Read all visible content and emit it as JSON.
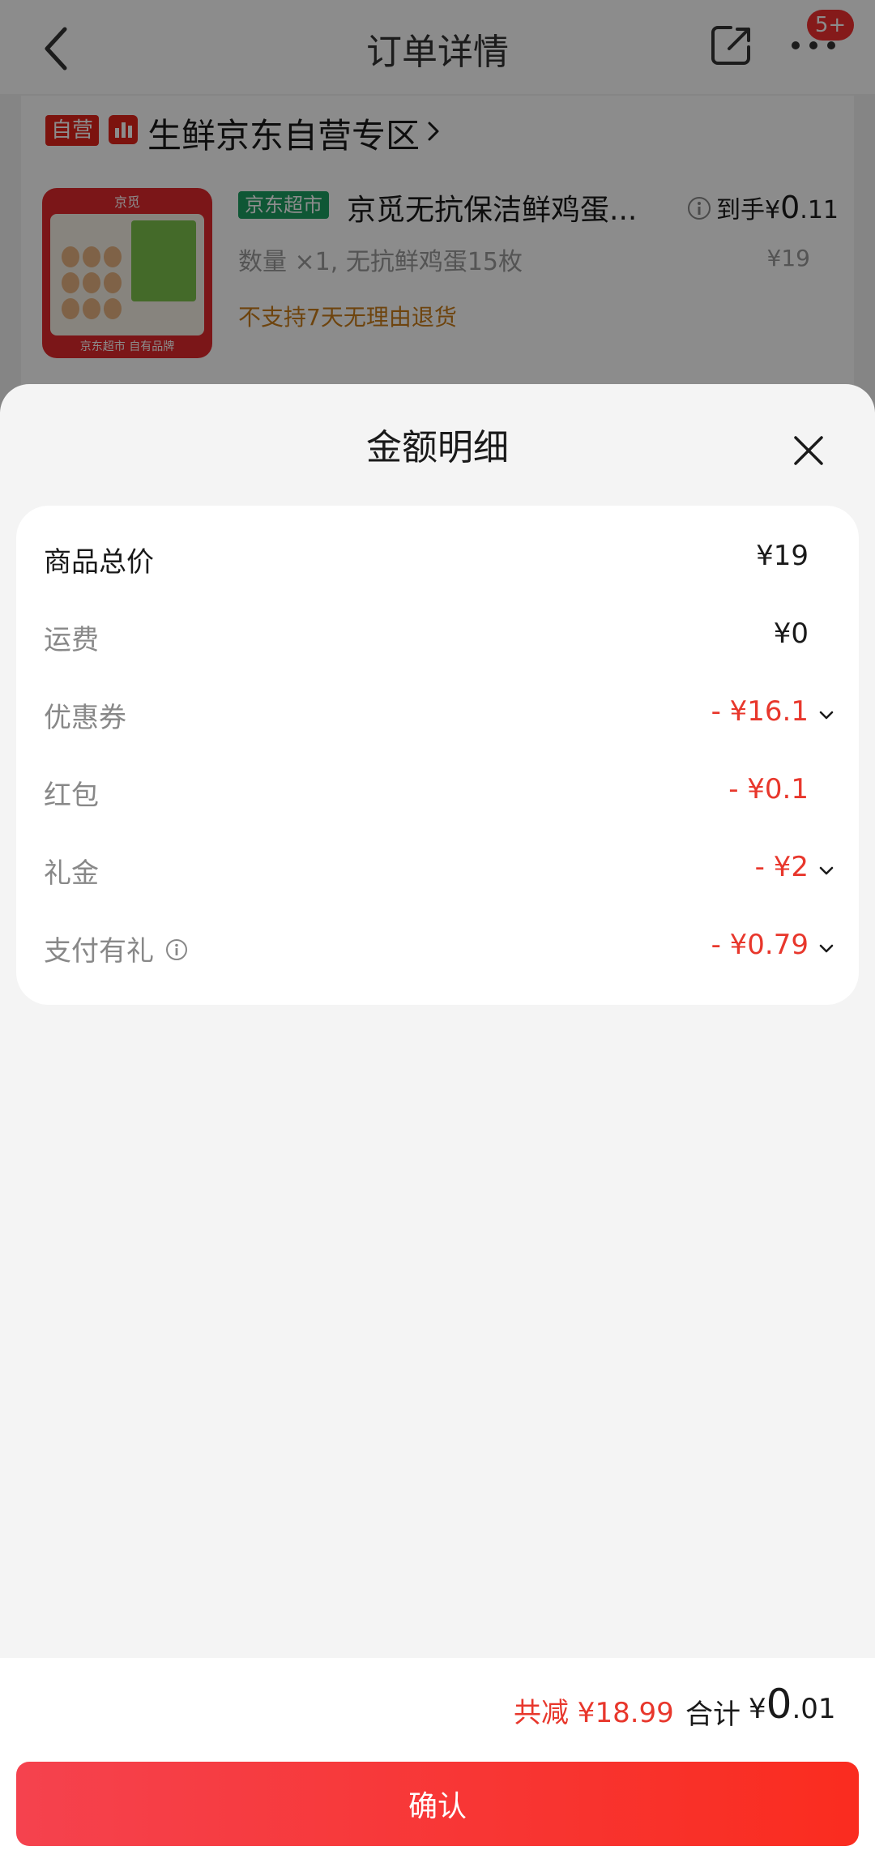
{
  "header": {
    "title": "订单详情",
    "badge": "5+"
  },
  "store": {
    "self_tag": "自营",
    "name": "生鲜京东自营专区"
  },
  "product": {
    "thumb_logo": "京觅",
    "thumb_footer": "京东超市 自有品牌",
    "channel_tag": "京东超市",
    "name": "京觅无抗保洁鲜鸡蛋...",
    "arrive_label": "到手",
    "arrive_currency": "¥",
    "arrive_int": "0",
    "arrive_dec": ".11",
    "quantity": "数量 ×1, 无抗鲜鸡蛋15枚",
    "original_price": "¥19",
    "return_policy": "不支持7天无理由退货"
  },
  "sheet": {
    "title": "金额明细",
    "rows": [
      {
        "label": "商品总价",
        "value": "¥19"
      },
      {
        "label": "运费",
        "value": "¥0"
      },
      {
        "label": "优惠券",
        "value": "- ¥16.1"
      },
      {
        "label": "红包",
        "value": "- ¥0.1"
      },
      {
        "label": "礼金",
        "value": "- ¥2"
      },
      {
        "label": "支付有礼",
        "value": "- ¥0.79"
      }
    ]
  },
  "footer": {
    "saved": "共减 ¥18.99",
    "total_label": "合计",
    "total_currency": "¥",
    "total_int": "0",
    "total_dec": ".01",
    "confirm_label": "确认"
  },
  "colors": {
    "accent_red": "#e8372c",
    "button_gradient_start": "#f5424e",
    "button_gradient_end": "#fa2c1f",
    "supermarket_green": "#1c9e62"
  }
}
